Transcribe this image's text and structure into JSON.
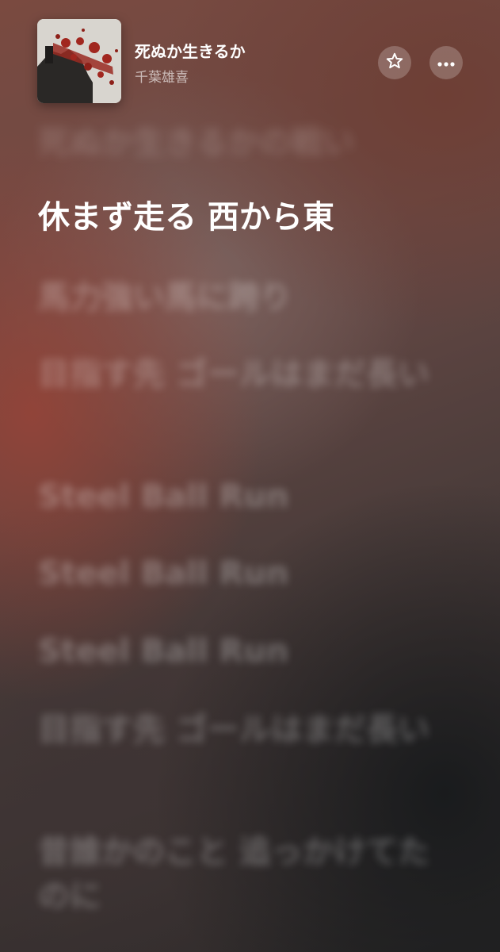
{
  "song": {
    "title": "死ぬか生きるか",
    "artist": "千葉雄喜"
  },
  "icons": {
    "favorite": "star-outline-icon",
    "more": "ellipsis-icon"
  },
  "colors": {
    "accent_red": "#9a3b30",
    "active_text": "#ffffff"
  },
  "lyrics": {
    "lines": [
      {
        "text": "死ぬか生きるかの戦い",
        "state": "past"
      },
      {
        "text": "休まず走る 西から東",
        "state": "active"
      },
      {
        "text": "馬力強い馬に跨り",
        "state": "upcoming"
      },
      {
        "text": "目指す先 ゴールはまだ長い",
        "state": "upcoming"
      },
      {
        "text": "Steel Ball Run",
        "state": "upcoming"
      },
      {
        "text": "Steel Ball Run",
        "state": "upcoming"
      },
      {
        "text": "Steel Ball Run",
        "state": "upcoming"
      },
      {
        "text": "目指す先 ゴールはまだ長い",
        "state": "upcoming"
      },
      {
        "text": "昔誰かのこと 追っかけてたのに",
        "state": "upcoming"
      }
    ]
  }
}
